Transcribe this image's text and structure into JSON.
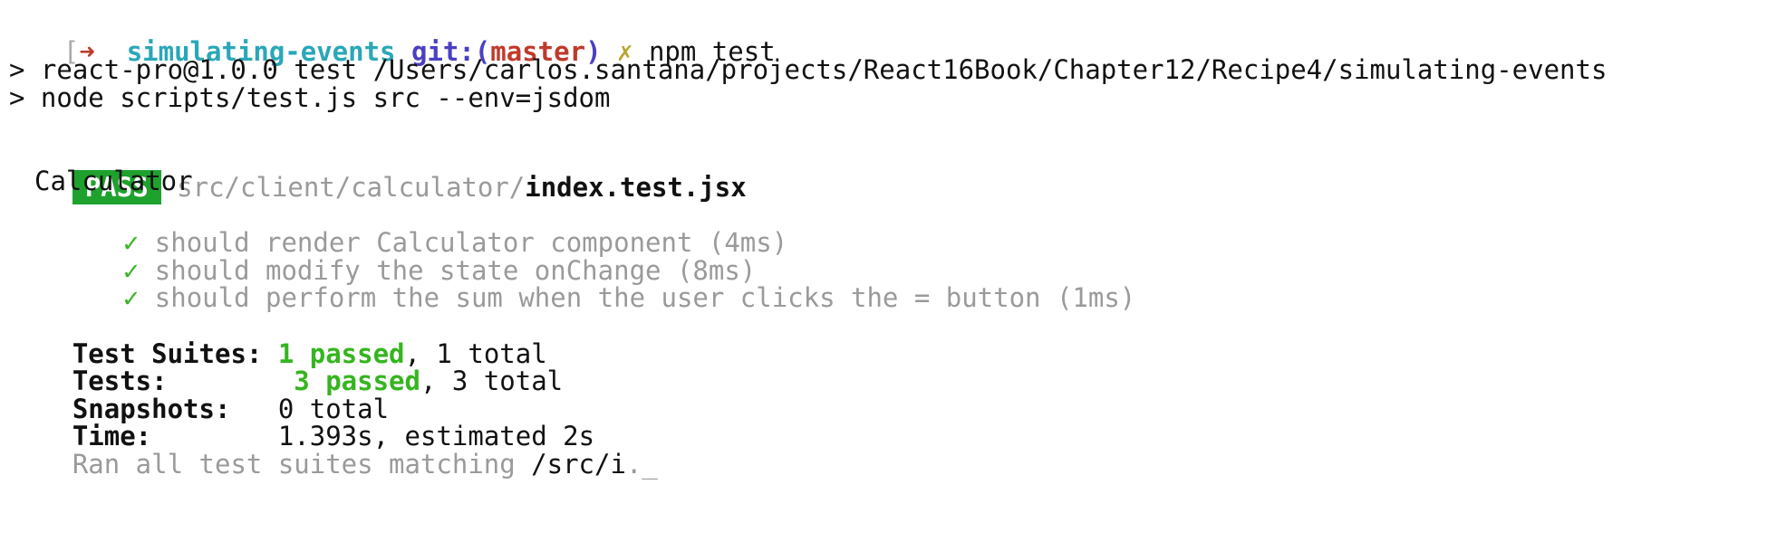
{
  "prompt": {
    "left_bracket": "[",
    "arrow": "➜",
    "directory": "simulating-events",
    "git_label": "git:",
    "branch_open": "(",
    "branch": "master",
    "branch_close": ")",
    "dirty_marker": "✗",
    "command": "npm test"
  },
  "script_lines": [
    "> react-pro@1.0.0 test /Users/carlos.santana/projects/React16Book/Chapter12/Recipe4/simulating-events",
    "> node scripts/test.js src --env=jsdom"
  ],
  "result": {
    "badge": "PASS",
    "path_dir": "src/client/calculator/",
    "path_file": "index.test.jsx",
    "suite_name": "Calculator",
    "check_glyph": "✓",
    "tests": [
      "should render Calculator component (4ms)",
      "should modify the state onChange (8ms)",
      "should perform the sum when the user clicks the = button (1ms)"
    ]
  },
  "summary": {
    "suites_label": "Test Suites:",
    "suites_passed": "1 passed",
    "suites_total": ", 1 total",
    "tests_label": "Tests:",
    "tests_passed": "3 passed",
    "tests_total": ", 3 total",
    "snapshots_label": "Snapshots:",
    "snapshots_value": "0 total",
    "time_label": "Time:",
    "time_value": "1.393s, estimated 2s",
    "ran_prefix": "Ran all test suites matching ",
    "ran_pattern": "/src/i",
    "ran_suffix": ".",
    "cursor": "_"
  },
  "colors": {
    "pass_badge": "#1fa12e",
    "passed_text": "#35b51f",
    "directory": "#2aa7b8",
    "branch": "#c0392b",
    "git_label": "#4a3fc4",
    "dim_text": "#9a9a9a"
  }
}
